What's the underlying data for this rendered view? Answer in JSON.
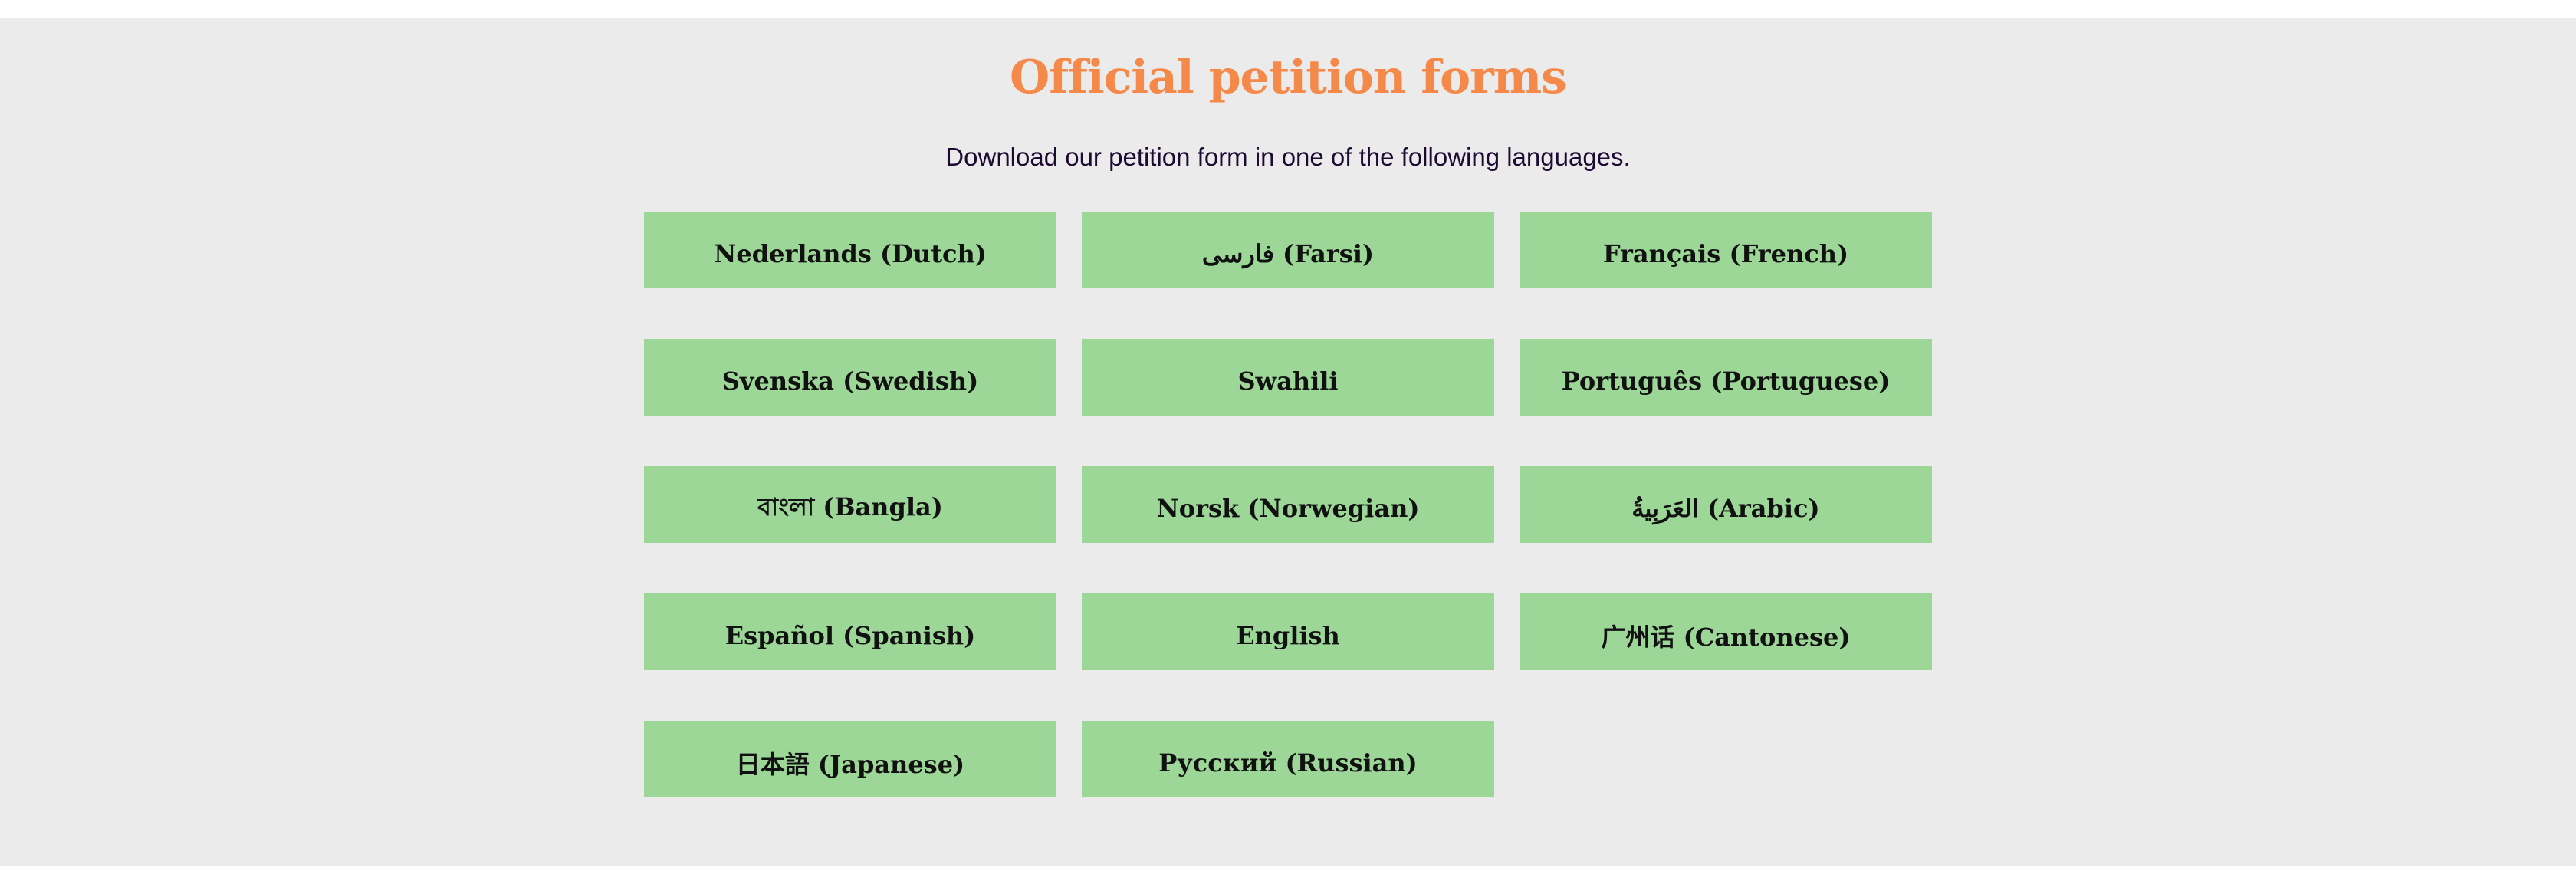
{
  "section": {
    "title": "Official petition forms",
    "subtitle": "Download our petition form in one of the following languages."
  },
  "languages": [
    {
      "label": "Nederlands (Dutch)"
    },
    {
      "label": "فارسی (Farsi)"
    },
    {
      "label": "Français (French)"
    },
    {
      "label": "Svenska (Swedish)"
    },
    {
      "label": "Swahili"
    },
    {
      "label": "Português (Portuguese)"
    },
    {
      "label": "বাংলা (Bangla)"
    },
    {
      "label": "Norsk (Norwegian)"
    },
    {
      "label": "العَرَبِيةُ (Arabic)"
    },
    {
      "label": "Español (Spanish)"
    },
    {
      "label": "English"
    },
    {
      "label": "广州话 (Cantonese)"
    },
    {
      "label": "日本語 (Japanese)"
    },
    {
      "label": "Русский (Russian)"
    }
  ],
  "colors": {
    "panel_background": "#ebebeb",
    "title": "#f4894a",
    "subtitle": "#1d0a33",
    "button_background": "#9dd797",
    "button_text": "#111111"
  }
}
